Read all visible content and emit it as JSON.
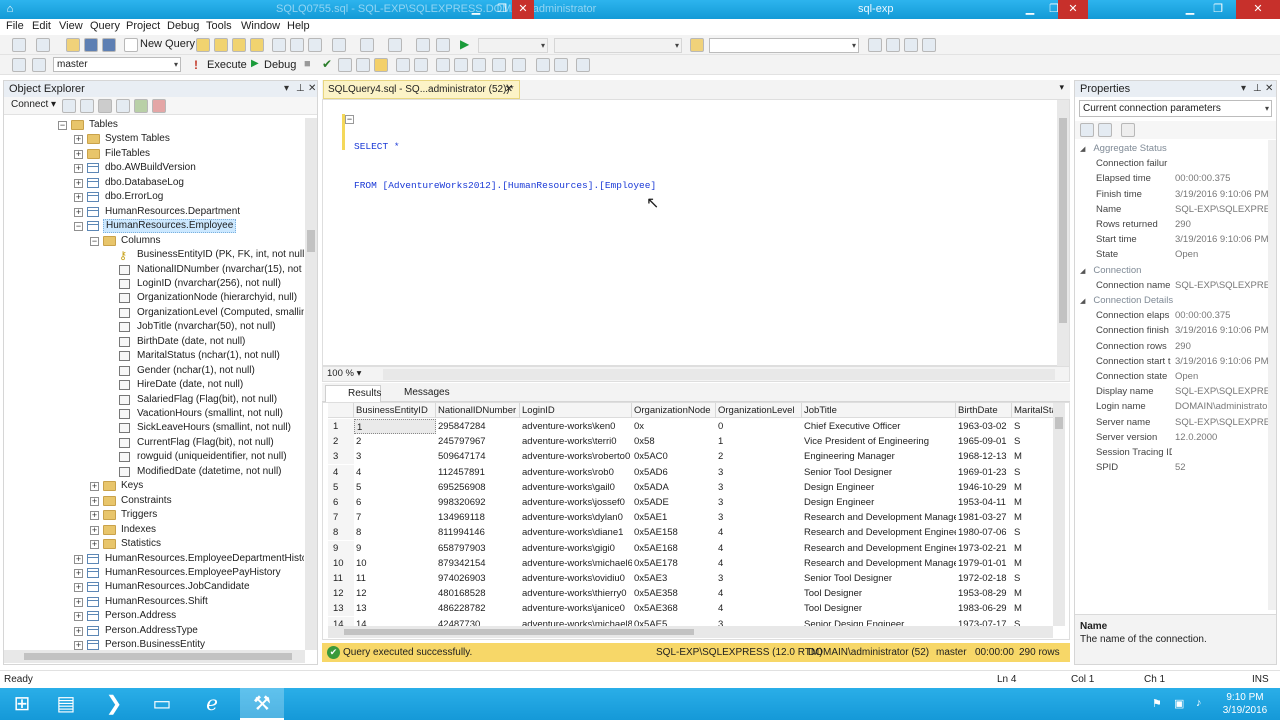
{
  "window": {
    "left_title": "SQLQuery4.sql - SQL-EXP\\SQLEXPRESS.master (DOMAIN\\administrator (52))",
    "left_title_visible": "SQLQ0755.sql - SQL-EXP\\SQLEXPRESS.DOMAIN\\administrator",
    "right_title": "sql-exp"
  },
  "menu": [
    "File",
    "Edit",
    "View",
    "Query",
    "Project",
    "Debug",
    "Tools",
    "Window",
    "Help"
  ],
  "toolbar": {
    "new_query": "New Query",
    "database": "master",
    "execute": "Execute",
    "debug": "Debug"
  },
  "object_explorer": {
    "title": "Object Explorer",
    "connect": "Connect",
    "items": [
      {
        "label": "Tables",
        "level": 3,
        "expander": "-",
        "icon": "folder"
      },
      {
        "label": "System Tables",
        "level": 4,
        "expander": "+",
        "icon": "folder"
      },
      {
        "label": "FileTables",
        "level": 4,
        "expander": "+",
        "icon": "folder"
      },
      {
        "label": "dbo.AWBuildVersion",
        "level": 4,
        "expander": "+",
        "icon": "table"
      },
      {
        "label": "dbo.DatabaseLog",
        "level": 4,
        "expander": "+",
        "icon": "table"
      },
      {
        "label": "dbo.ErrorLog",
        "level": 4,
        "expander": "+",
        "icon": "table"
      },
      {
        "label": "HumanResources.Department",
        "level": 4,
        "expander": "+",
        "icon": "table"
      },
      {
        "label": "HumanResources.Employee",
        "level": 4,
        "expander": "-",
        "icon": "table",
        "selected": true
      },
      {
        "label": "Columns",
        "level": 5,
        "expander": "-",
        "icon": "folder"
      },
      {
        "label": "BusinessEntityID (PK, FK, int, not null)",
        "level": 6,
        "expander": "",
        "icon": "key"
      },
      {
        "label": "NationalIDNumber (nvarchar(15), not nu",
        "level": 6,
        "expander": "",
        "icon": "column"
      },
      {
        "label": "LoginID (nvarchar(256), not null)",
        "level": 6,
        "expander": "",
        "icon": "column"
      },
      {
        "label": "OrganizationNode (hierarchyid, null)",
        "level": 6,
        "expander": "",
        "icon": "column"
      },
      {
        "label": "OrganizationLevel (Computed, smallint, n",
        "level": 6,
        "expander": "",
        "icon": "column"
      },
      {
        "label": "JobTitle (nvarchar(50), not null)",
        "level": 6,
        "expander": "",
        "icon": "column"
      },
      {
        "label": "BirthDate (date, not null)",
        "level": 6,
        "expander": "",
        "icon": "column"
      },
      {
        "label": "MaritalStatus (nchar(1), not null)",
        "level": 6,
        "expander": "",
        "icon": "column"
      },
      {
        "label": "Gender (nchar(1), not null)",
        "level": 6,
        "expander": "",
        "icon": "column"
      },
      {
        "label": "HireDate (date, not null)",
        "level": 6,
        "expander": "",
        "icon": "column"
      },
      {
        "label": "SalariedFlag (Flag(bit), not null)",
        "level": 6,
        "expander": "",
        "icon": "column"
      },
      {
        "label": "VacationHours (smallint, not null)",
        "level": 6,
        "expander": "",
        "icon": "column"
      },
      {
        "label": "SickLeaveHours (smallint, not null)",
        "level": 6,
        "expander": "",
        "icon": "column"
      },
      {
        "label": "CurrentFlag (Flag(bit), not null)",
        "level": 6,
        "expander": "",
        "icon": "column"
      },
      {
        "label": "rowguid (uniqueidentifier, not null)",
        "level": 6,
        "expander": "",
        "icon": "column"
      },
      {
        "label": "ModifiedDate (datetime, not null)",
        "level": 6,
        "expander": "",
        "icon": "column"
      },
      {
        "label": "Keys",
        "level": 5,
        "expander": "+",
        "icon": "folder"
      },
      {
        "label": "Constraints",
        "level": 5,
        "expander": "+",
        "icon": "folder"
      },
      {
        "label": "Triggers",
        "level": 5,
        "expander": "+",
        "icon": "folder"
      },
      {
        "label": "Indexes",
        "level": 5,
        "expander": "+",
        "icon": "folder"
      },
      {
        "label": "Statistics",
        "level": 5,
        "expander": "+",
        "icon": "folder"
      },
      {
        "label": "HumanResources.EmployeeDepartmentHistory",
        "level": 4,
        "expander": "+",
        "icon": "table"
      },
      {
        "label": "HumanResources.EmployeePayHistory",
        "level": 4,
        "expander": "+",
        "icon": "table"
      },
      {
        "label": "HumanResources.JobCandidate",
        "level": 4,
        "expander": "+",
        "icon": "table"
      },
      {
        "label": "HumanResources.Shift",
        "level": 4,
        "expander": "+",
        "icon": "table"
      },
      {
        "label": "Person.Address",
        "level": 4,
        "expander": "+",
        "icon": "table"
      },
      {
        "label": "Person.AddressType",
        "level": 4,
        "expander": "+",
        "icon": "table"
      },
      {
        "label": "Person.BusinessEntity",
        "level": 4,
        "expander": "+",
        "icon": "table"
      }
    ]
  },
  "editor": {
    "tab": "SQLQuery4.sql - SQ...administrator (52))*",
    "line1": "SELECT *",
    "line2": "FROM [AdventureWorks2012].[HumanResources].[Employee]",
    "zoom": "100 %"
  },
  "results": {
    "tab_results": "Results",
    "tab_messages": "Messages",
    "columns": [
      "BusinessEntityID",
      "NationalIDNumber",
      "LoginID",
      "OrganizationNode",
      "OrganizationLevel",
      "JobTitle",
      "BirthDate",
      "MaritalStatu"
    ],
    "rows": [
      [
        "1",
        "1",
        "295847284",
        "adventure-works\\ken0",
        "0x",
        "0",
        "Chief Executive Officer",
        "1963-03-02",
        "S"
      ],
      [
        "2",
        "2",
        "245797967",
        "adventure-works\\terri0",
        "0x58",
        "1",
        "Vice President of Engineering",
        "1965-09-01",
        "S"
      ],
      [
        "3",
        "3",
        "509647174",
        "adventure-works\\roberto0",
        "0x5AC0",
        "2",
        "Engineering Manager",
        "1968-12-13",
        "M"
      ],
      [
        "4",
        "4",
        "112457891",
        "adventure-works\\rob0",
        "0x5AD6",
        "3",
        "Senior Tool Designer",
        "1969-01-23",
        "S"
      ],
      [
        "5",
        "5",
        "695256908",
        "adventure-works\\gail0",
        "0x5ADA",
        "3",
        "Design Engineer",
        "1946-10-29",
        "M"
      ],
      [
        "6",
        "6",
        "998320692",
        "adventure-works\\jossef0",
        "0x5ADE",
        "3",
        "Design Engineer",
        "1953-04-11",
        "M"
      ],
      [
        "7",
        "7",
        "134969118",
        "adventure-works\\dylan0",
        "0x5AE1",
        "3",
        "Research and Development Manager",
        "1981-03-27",
        "M"
      ],
      [
        "8",
        "8",
        "811994146",
        "adventure-works\\diane1",
        "0x5AE158",
        "4",
        "Research and Development Engineer",
        "1980-07-06",
        "S"
      ],
      [
        "9",
        "9",
        "658797903",
        "adventure-works\\gigi0",
        "0x5AE168",
        "4",
        "Research and Development Engineer",
        "1973-02-21",
        "M"
      ],
      [
        "10",
        "10",
        "879342154",
        "adventure-works\\michael6",
        "0x5AE178",
        "4",
        "Research and Development Manager",
        "1979-01-01",
        "M"
      ],
      [
        "11",
        "11",
        "974026903",
        "adventure-works\\ovidiu0",
        "0x5AE3",
        "3",
        "Senior Tool Designer",
        "1972-02-18",
        "S"
      ],
      [
        "12",
        "12",
        "480168528",
        "adventure-works\\thierry0",
        "0x5AE358",
        "4",
        "Tool Designer",
        "1953-08-29",
        "M"
      ],
      [
        "13",
        "13",
        "486228782",
        "adventure-works\\janice0",
        "0x5AE368",
        "4",
        "Tool Designer",
        "1983-06-29",
        "M"
      ],
      [
        "14",
        "14",
        "42487730",
        "adventure-works\\michael8",
        "0x5AE5",
        "3",
        "Senior Design Engineer",
        "1973-07-17",
        "S"
      ]
    ]
  },
  "query_status": {
    "message": "Query executed successfully.",
    "server": "SQL-EXP\\SQLEXPRESS (12.0 RTM)",
    "user": "DOMAIN\\administrator (52)",
    "database": "master",
    "elapsed": "00:00:00",
    "rows": "290 rows"
  },
  "properties": {
    "title": "Properties",
    "selector": "Current connection parameters",
    "rows": [
      {
        "type": "cat",
        "name": "Aggregate Status"
      },
      {
        "type": "prop",
        "name": "Connection failur",
        "value": ""
      },
      {
        "type": "prop",
        "name": "Elapsed time",
        "value": "00:00:00.375"
      },
      {
        "type": "prop",
        "name": "Finish time",
        "value": "3/19/2016 9:10:06 PM"
      },
      {
        "type": "prop",
        "name": "Name",
        "value": "SQL-EXP\\SQLEXPRESS"
      },
      {
        "type": "prop",
        "name": "Rows returned",
        "value": "290"
      },
      {
        "type": "prop",
        "name": "Start time",
        "value": "3/19/2016 9:10:06 PM"
      },
      {
        "type": "prop",
        "name": "State",
        "value": "Open"
      },
      {
        "type": "cat",
        "name": "Connection"
      },
      {
        "type": "prop",
        "name": "Connection name",
        "value": "SQL-EXP\\SQLEXPRESS ("
      },
      {
        "type": "cat",
        "name": "Connection Details"
      },
      {
        "type": "prop",
        "name": "Connection elaps",
        "value": "00:00:00.375"
      },
      {
        "type": "prop",
        "name": "Connection finish",
        "value": "3/19/2016 9:10:06 PM"
      },
      {
        "type": "prop",
        "name": "Connection rows",
        "value": "290"
      },
      {
        "type": "prop",
        "name": "Connection start t",
        "value": "3/19/2016 9:10:06 PM"
      },
      {
        "type": "prop",
        "name": "Connection state",
        "value": "Open"
      },
      {
        "type": "prop",
        "name": "Display name",
        "value": "SQL-EXP\\SQLEXPRESS"
      },
      {
        "type": "prop",
        "name": "Login name",
        "value": "DOMAIN\\administrator"
      },
      {
        "type": "prop",
        "name": "Server name",
        "value": "SQL-EXP\\SQLEXPRESS"
      },
      {
        "type": "prop",
        "name": "Server version",
        "value": "12.0.2000"
      },
      {
        "type": "prop",
        "name": "Session Tracing ID",
        "value": ""
      },
      {
        "type": "prop",
        "name": "SPID",
        "value": "52"
      }
    ],
    "desc_title": "Name",
    "desc_text": "The name of the connection."
  },
  "statusbar": {
    "left": "Ready",
    "ln": "Ln 4",
    "col": "Col 1",
    "ch": "Ch 1",
    "ins": "INS"
  },
  "taskbar": {
    "time": "9:10 PM",
    "date": "3/19/2016"
  },
  "colors": {
    "accent": "#1599d8",
    "query_status_bg": "#f7d768",
    "selection": "#cce8ff"
  }
}
